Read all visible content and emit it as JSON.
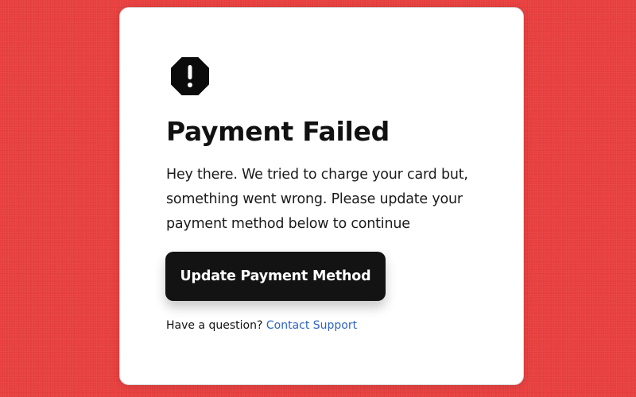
{
  "card": {
    "icon": "alert-octagon-icon",
    "title": "Payment Failed",
    "message": "Hey there. We tried to charge your card but, something went wrong. Please update your payment method below to continue",
    "button_label": "Update Payment Method",
    "help_text": "Have a question?",
    "help_link_label": "Contact Support"
  },
  "colors": {
    "background": "#e8403f",
    "card": "#ffffff",
    "button": "#131313",
    "link": "#2f63c8"
  }
}
